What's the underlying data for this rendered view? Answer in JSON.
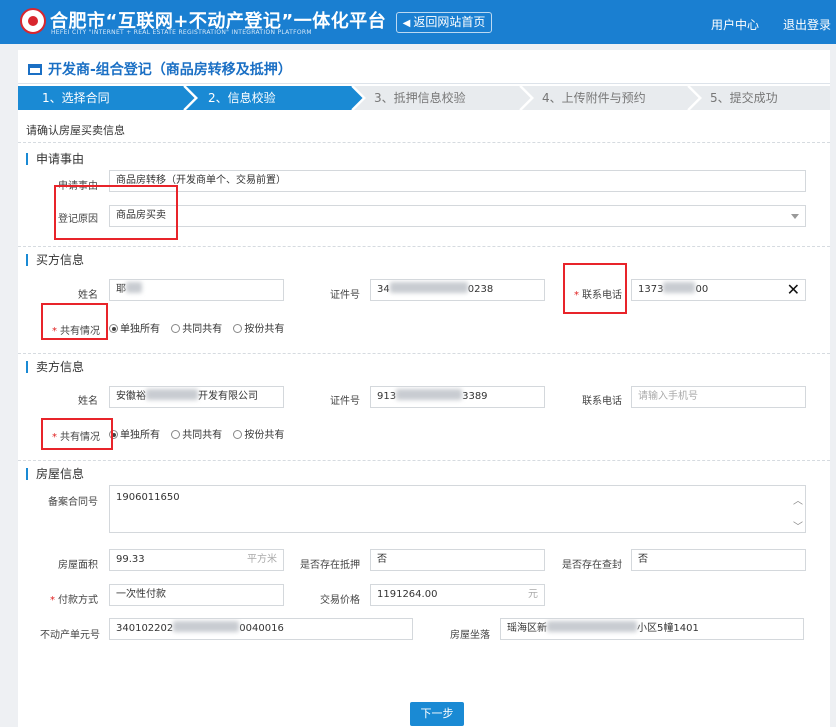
{
  "header": {
    "title": "合肥市“互联网+不动产登记”一体化平台",
    "subtitle": "HEFEI CITY \"INTERNET + REAL ESTATE REGISTRATION\" INTEGRATION PLATFORM",
    "back_label": "返回网站首页",
    "user_center": "用户中心",
    "logout": "退出登录"
  },
  "page": {
    "title": "开发商-组合登记（商品房转移及抵押）",
    "notice": "请确认房屋买卖信息"
  },
  "steps": [
    {
      "label": "1、选择合同",
      "state": "done"
    },
    {
      "label": "2、信息校验",
      "state": "current"
    },
    {
      "label": "3、抵押信息校验",
      "state": "todo"
    },
    {
      "label": "4、上传附件与预约",
      "state": "todo"
    },
    {
      "label": "5、提交成功",
      "state": "todo"
    }
  ],
  "apply": {
    "section": "申请事由",
    "reason_label": "申请事由",
    "reason_value": "商品房转移（开发商单个、交易前置）",
    "cause_label": "登记原因",
    "cause_value": "商品房买卖"
  },
  "buyer": {
    "section": "买方信息",
    "name_label": "姓名",
    "name_value": "耶",
    "id_label": "证件号",
    "id_prefix": "34",
    "id_suffix": "0238",
    "phone_label": "联系电话",
    "phone_prefix": "1373",
    "phone_suffix": "00",
    "share_label": "共有情况",
    "share_options": [
      "单独所有",
      "共同共有",
      "按份共有"
    ]
  },
  "seller": {
    "section": "卖方信息",
    "name_label": "姓名",
    "name_prefix": "安徽裕",
    "name_suffix": "开发有限公司",
    "id_label": "证件号",
    "id_prefix": "913",
    "id_suffix": "3389",
    "phone_label": "联系电话",
    "phone_placeholder": "请输入手机号",
    "share_label": "共有情况",
    "share_options": [
      "单独所有",
      "共同共有",
      "按份共有"
    ]
  },
  "house": {
    "section": "房屋信息",
    "contract_label": "备案合同号",
    "contract_value": "1906011650",
    "area_label": "房屋面积",
    "area_value": "99.33",
    "area_unit": "平方米",
    "mortgage_label": "是否存在抵押",
    "mortgage_value": "否",
    "seal_label": "是否存在查封",
    "seal_value": "否",
    "pay_label": "付款方式",
    "pay_value": "一次性付款",
    "price_label": "交易价格",
    "price_value": "1191264.00",
    "price_unit": "元",
    "unit_no_label": "不动产单元号",
    "unit_no_prefix": "340102202",
    "unit_no_suffix": "0040016",
    "location_label": "房屋坐落",
    "location_prefix": "瑶海区新",
    "location_suffix": "小区5幢1401"
  },
  "next_button": "下一步"
}
